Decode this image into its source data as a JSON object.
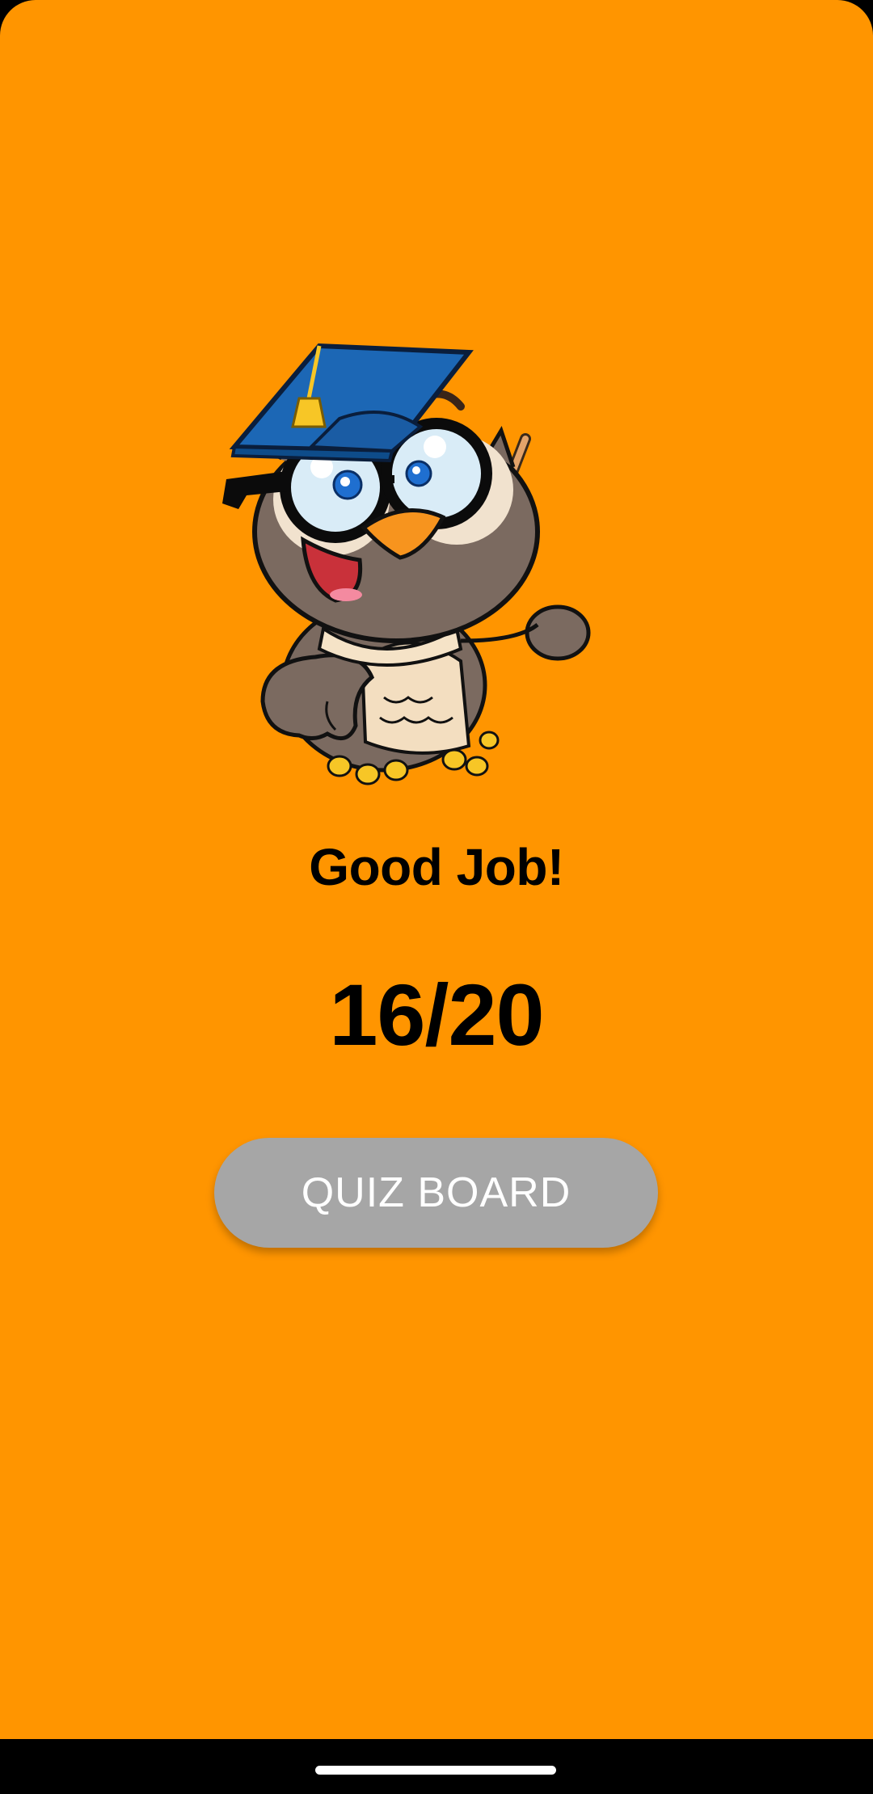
{
  "result": {
    "title": "Good Job!",
    "score": "16/20"
  },
  "actions": {
    "quiz_board_label": "QUIZ BOARD"
  },
  "illustration": {
    "name": "owl-teacher-illustration",
    "icon": "owl-with-graduation-cap-and-pointer"
  },
  "colors": {
    "background": "#FF9500",
    "button": "#A6A6A6",
    "button_text": "#FFFFFF",
    "text": "#000000",
    "system_nav": "#000000"
  }
}
